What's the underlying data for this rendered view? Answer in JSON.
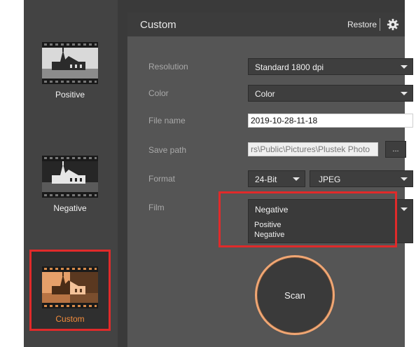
{
  "sidebar": {
    "modes": [
      {
        "label": "Positive",
        "icon": "film-church-positive-icon"
      },
      {
        "label": "Negative",
        "icon": "film-church-negative-icon"
      },
      {
        "label": "Custom",
        "icon": "film-church-custom-icon"
      }
    ]
  },
  "header": {
    "title": "Custom",
    "restore_label": "Restore",
    "settings_icon": "gear-icon"
  },
  "form": {
    "resolution": {
      "label": "Resolution",
      "value": "Standard 1800 dpi"
    },
    "color": {
      "label": "Color",
      "value": "Color"
    },
    "file_name": {
      "label": "File name",
      "value": "2019-10-28-11-18"
    },
    "save_path": {
      "label": "Save path",
      "value": "rs\\Public\\Pictures\\Plustek Photo",
      "browse_label": "..."
    },
    "format": {
      "label": "Format",
      "bit_depth": "24-Bit",
      "file_type": "JPEG"
    },
    "film": {
      "label": "Film",
      "value": "Negative",
      "options": [
        "Positive",
        "Negative"
      ]
    }
  },
  "scan": {
    "label": "Scan"
  },
  "colors": {
    "highlight": "#e02a2a",
    "scan_ring": "#f0a673",
    "custom_accent": "#f28c3c"
  }
}
